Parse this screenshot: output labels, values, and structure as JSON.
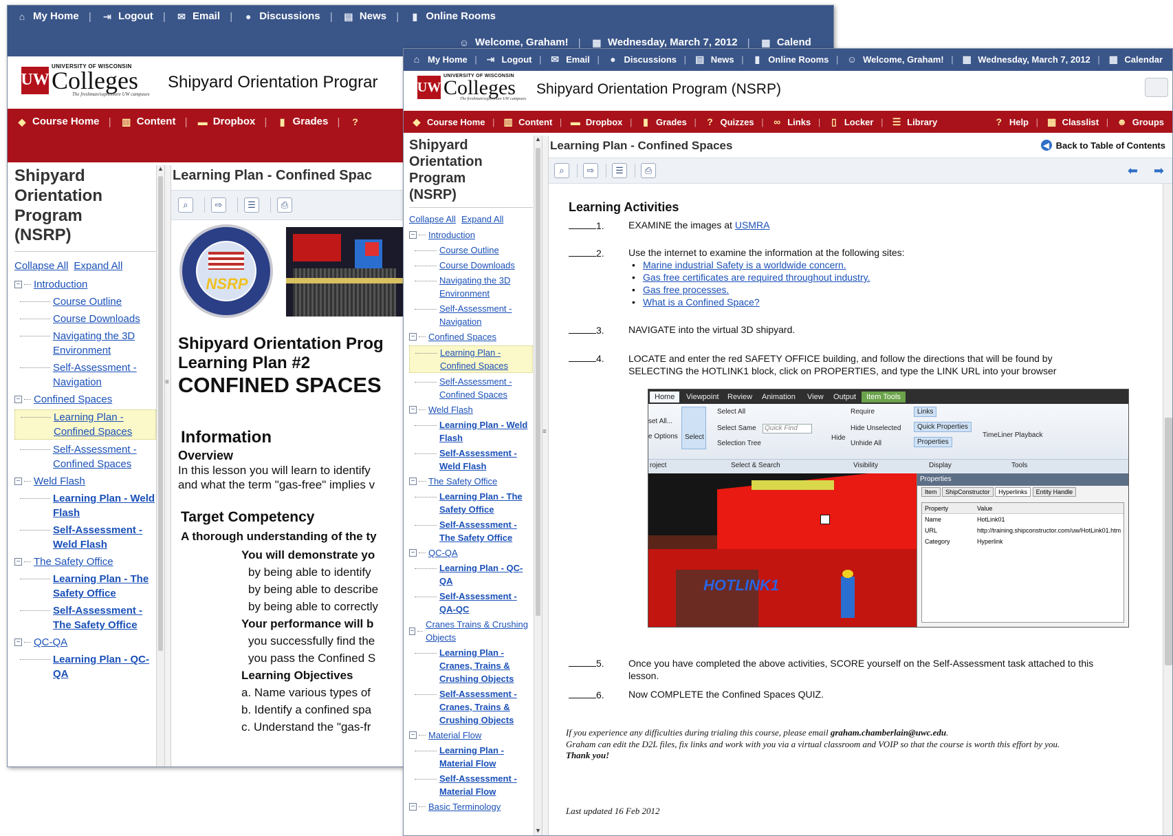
{
  "topnav": {
    "home": "My Home",
    "logout": "Logout",
    "email": "Email",
    "discussions": "Discussions",
    "news": "News",
    "online_rooms": "Online Rooms",
    "welcome": "Welcome, Graham!",
    "date": "Wednesday, March 7, 2012",
    "calendar": "Calendar",
    "calendar_cut": "Calend"
  },
  "logo": {
    "uw": "UNIVERSITY OF WISCONSIN",
    "mark": "UW",
    "colleges": "Colleges",
    "tagline": "The freshman/sophomore UW campuses"
  },
  "back_window": {
    "course_title": "Shipyard Orientation Prograr",
    "nav": {
      "course_home": "Course Home",
      "content": "Content",
      "dropbox": "Dropbox",
      "grades": "Grades"
    },
    "tree_title": [
      "Shipyard",
      "Orientation",
      "Program",
      "(NSRP)"
    ],
    "collapse_all": "Collapse All",
    "expand_all": "Expand All",
    "tree": [
      {
        "type": "module",
        "label": "Introduction"
      },
      {
        "type": "topic",
        "label": "Course Outline"
      },
      {
        "type": "topic",
        "label": "Course Downloads"
      },
      {
        "type": "topic",
        "label": "Navigating the 3D Environment"
      },
      {
        "type": "topic",
        "label": "Self-Assessment - Navigation"
      },
      {
        "type": "module",
        "label": "Confined Spaces"
      },
      {
        "type": "topic",
        "label": "Learning Plan - Confined Spaces",
        "selected": true
      },
      {
        "type": "topic",
        "label": "Self-Assessment - Confined Spaces"
      },
      {
        "type": "module",
        "label": "Weld Flash"
      },
      {
        "type": "topic",
        "label": "Learning Plan - Weld Flash",
        "bold": true
      },
      {
        "type": "topic",
        "label": "Self-Assessment - Weld Flash",
        "bold": true
      },
      {
        "type": "module",
        "label": "The Safety Office"
      },
      {
        "type": "topic",
        "label": "Learning Plan - The Safety Office",
        "bold": true
      },
      {
        "type": "topic",
        "label": "Self-Assessment - The Safety Office",
        "bold": true
      },
      {
        "type": "module",
        "label": "QC-QA"
      },
      {
        "type": "topic",
        "label": "Learning Plan - QC-QA",
        "bold": true
      }
    ],
    "content_title": "Learning Plan - Confined Spac",
    "nsrp_seal": "NSRP",
    "heading1": "Shipyard Orientation Prog",
    "heading2": "Learning Plan #2",
    "heading3": "CONFINED SPACES",
    "information": "Information",
    "overview": "Overview",
    "overview_text_1": "In this lesson you will learn to identify",
    "overview_text_2": "and what the term \"gas-free\" implies v",
    "target": "Target Competency",
    "target_text": "A thorough understanding of the ty",
    "demonstrate": "You will demonstrate yo",
    "by1": "by being able to identify",
    "by2": "by being able to describe",
    "by3": "by being able to correctly",
    "performance": "Your performance will b",
    "perf1": "you successfully find the",
    "perf2": "you pass the Confined S",
    "objectives": "Learning Objectives",
    "obj_a": "a.  Name various types of",
    "obj_b": "b.  Identify a confined spa",
    "obj_c": "c.  Understand the \"gas-fr"
  },
  "front_window": {
    "course_title": "Shipyard Orientation Program (NSRP)",
    "nav": {
      "course_home": "Course Home",
      "content": "Content",
      "dropbox": "Dropbox",
      "grades": "Grades",
      "quizzes": "Quizzes",
      "links": "Links",
      "locker": "Locker",
      "library": "Library",
      "help": "Help",
      "classlist": "Classlist",
      "groups": "Groups"
    },
    "tree_title": [
      "Shipyard",
      "Orientation",
      "Program",
      "(NSRP)"
    ],
    "collapse_all": "Collapse All",
    "expand_all": "Expand All",
    "tree": [
      {
        "type": "module",
        "label": "Introduction"
      },
      {
        "type": "topic",
        "label": "Course Outline"
      },
      {
        "type": "topic",
        "label": "Course Downloads"
      },
      {
        "type": "topic",
        "label": "Navigating the 3D Environment"
      },
      {
        "type": "topic",
        "label": "Self-Assessment - Navigation"
      },
      {
        "type": "module",
        "label": "Confined Spaces"
      },
      {
        "type": "topic",
        "label": "Learning Plan - Confined Spaces",
        "selected": true
      },
      {
        "type": "topic",
        "label": "Self-Assessment - Confined Spaces"
      },
      {
        "type": "module",
        "label": "Weld Flash"
      },
      {
        "type": "topic",
        "label": "Learning Plan - Weld Flash",
        "bold": true
      },
      {
        "type": "topic",
        "label": "Self-Assessment - Weld Flash",
        "bold": true
      },
      {
        "type": "module",
        "label": "The Safety Office"
      },
      {
        "type": "topic",
        "label": "Learning Plan - The Safety Office",
        "bold": true
      },
      {
        "type": "topic",
        "label": "Self-Assessment - The Safety Office",
        "bold": true
      },
      {
        "type": "module",
        "label": "QC-QA"
      },
      {
        "type": "topic",
        "label": "Learning Plan - QC-QA",
        "bold": true
      },
      {
        "type": "topic",
        "label": "Self-Assessment - QA-QC",
        "bold": true
      },
      {
        "type": "module",
        "label": "Cranes Trains & Crushing Objects"
      },
      {
        "type": "topic",
        "label": "Learning Plan - Cranes, Trains & Crushing Objects",
        "bold": true
      },
      {
        "type": "topic",
        "label": "Self-Assessment - Cranes, Trains & Crushing Objects",
        "bold": true
      },
      {
        "type": "module",
        "label": "Material Flow"
      },
      {
        "type": "topic",
        "label": "Learning Plan - Material Flow",
        "bold": true
      },
      {
        "type": "topic",
        "label": "Self-Assessment - Material Flow",
        "bold": true
      },
      {
        "type": "module",
        "label": "Basic Terminology"
      }
    ],
    "content_title": "Learning Plan - Confined Spaces",
    "back_toc": "Back to Table of Contents",
    "activities_heading": "Learning Activities",
    "items": {
      "n1": "1.",
      "t1": "EXAMINE the images at ",
      "link1": "USMRA ",
      "n2": "2.",
      "t2": "Use the internet to examine the information at the following sites:",
      "links2": [
        "Marine industrial Safety is a worldwide concern.",
        "Gas free certificates are required throughout industry.",
        "Gas free processes.",
        "What is a Confined Space?"
      ],
      "n3": "3.",
      "t3": "NAVIGATE into the virtual 3D shipyard.",
      "n4": "4.",
      "t4a": "LOCATE and enter the red SAFETY OFFICE building, and follow the directions that will be found by",
      "t4b": "SELECTING the HOTLINK1 block, click on PROPERTIES, and type the LINK URL into your browser",
      "n5": "5.",
      "t5a": "Once you have completed the above activities, SCORE yourself on the Self-Assessment task attached to this",
      "t5b": "lesson.",
      "n6": "6.",
      "t6": "Now COMPLETE the Confined Spaces QUIZ."
    },
    "screenshot": {
      "tabs": [
        "Home",
        "Viewpoint",
        "Review",
        "Animation",
        "View",
        "Output",
        "Item Tools"
      ],
      "select_all": "Select All",
      "select_same": "Select Same",
      "quick_find": "Quick Find",
      "selection_tree": "Selection Tree",
      "select": "Select",
      "set_all": "set All...",
      "e_options": "e Options",
      "require": "Require",
      "hide_unselected": "Hide Unselected",
      "unhide_all": "Unhide All",
      "hide": "Hide",
      "links": "Links",
      "quick_properties": "Quick Properties",
      "properties": "Properties",
      "timeliner": "TimeLiner Playback",
      "groups": [
        "roject",
        "Select & Search",
        "Visibility",
        "Display",
        "Tools"
      ],
      "panel_title": "Properties",
      "panel_tabs": [
        "Item",
        "ShipConstructor",
        "Hyperlinks",
        "Entity Handle"
      ],
      "col_property": "Property",
      "col_value": "Value",
      "rows": [
        {
          "k": "Name",
          "v": "HotLink01"
        },
        {
          "k": "URL",
          "v": "http://training.shipconstructor.com/uw/HotLink01.htm"
        },
        {
          "k": "Category",
          "v": "Hyperlink"
        }
      ],
      "hotlink": "HOTLINK1"
    },
    "footnote1_pre": "If you experience any difficulties during trialing this course, please email ",
    "footnote1_email": "graham.chamberlain@uwc.edu",
    "footnote1_post": ".",
    "footnote2": "Graham can edit the D2L files, fix links and work with you via a virtual classroom and VOIP so that the course is worth this effort by you.",
    "thanks": "Thank you!",
    "last_updated": "Last updated 16 Feb 2012"
  }
}
